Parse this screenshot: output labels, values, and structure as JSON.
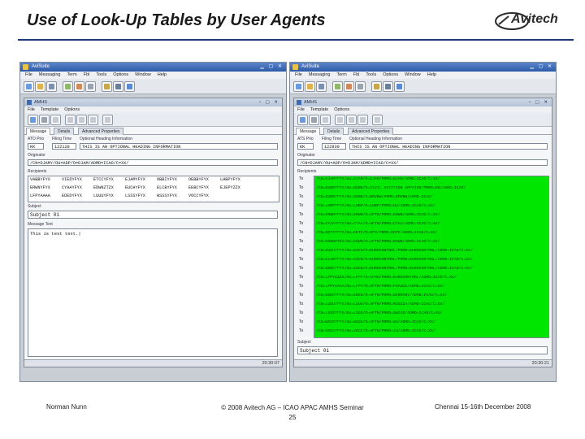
{
  "slide": {
    "title": "Use of Look-Up Tables by User Agents",
    "logo_text": "Avitech",
    "footer_left": "Norman Nunn",
    "footer_center_line1": "© 2008 Avitech AG – ICAO APAC AMHS Seminar",
    "footer_center_line2": "25",
    "footer_right": "Chennai 15-16th December 2008"
  },
  "left": {
    "app_title": "AviSuite",
    "menu": [
      "File",
      "Messaging",
      "Term",
      "Fbl",
      "Tools",
      "Options",
      "Window",
      "Help"
    ],
    "inner_title": "AMHS",
    "inner_menu": [
      "File",
      "Template",
      "Options"
    ],
    "tabs": [
      "Message",
      "Details",
      "Advanced Properties"
    ],
    "ato_label": "ATO Prio",
    "filing_label": "Filing Time",
    "heading_label": "Optional Heading Information",
    "prio": "KK",
    "filing_time": "122128",
    "heading_info": "THIS IS AN OPTIONAL HEADING INFORMATION",
    "originator_label": "Originator",
    "originator": "/CN=DJAMY/OU=ADP/O=DJAM/ADMD=ICAO/C=XX/",
    "recipients_label": "Recipients",
    "recipients": [
      [
        "VABBYFYX",
        "VIEDYFYX",
        "ETCCYFYX",
        "EJAMYFYX",
        "OBBIYFYX",
        "OEBBYFYX",
        "LHBPYFYX"
      ],
      [
        "ERWNYFYX",
        "CYAAYFYX",
        "EDWNZTZX",
        "EUCHYFYX",
        "ELCBYFYX",
        "EEBCYFYX",
        "EJEPYZZX"
      ],
      [
        "LFPYAAAA",
        "EDEDYFYX",
        "LUUUYFYX",
        "LSSSYFYX",
        "WSSSYFYX",
        "VOCCYFYX"
      ]
    ],
    "subject_label": "Subject",
    "subject": "Subject 01",
    "message_label": "Message Text",
    "message": "This is test text.",
    "status_time": "20:30:07"
  },
  "right": {
    "app_title": "AviSuite",
    "menu": [
      "File",
      "Messaging",
      "Term",
      "Fbl",
      "Tools",
      "Options",
      "Window",
      "Help"
    ],
    "inner_title": "AMHS",
    "inner_menu": [
      "File",
      "Template",
      "Options"
    ],
    "tabs": [
      "Message",
      "Details",
      "Advanced Properties"
    ],
    "ato_label": "ATS Prio",
    "filing_label": "Filing Time",
    "heading_label": "Optional Heading Information",
    "prio": "KK",
    "filing_time": "122930",
    "heading_info": "THIS IS AN OPTIONAL HEADING INFORMATION",
    "originator_label": "Originator",
    "originator": "/CN=DJAMY/OU=ADP/O=DJAM/ADMD=ICAO/C=XX/",
    "recipients_label": "Recipients",
    "to_label": "To",
    "recipients": [
      "/CN=DJAMYFYX/OU=DJAM/O=DJAM/PRMD=DJAM/ADMD=ICAO/C=XX/",
      "/CN=DUBBYFYX/OU=DUBB/O=CIVIL AVIATION AFFAIRS/PRMD=DB/ADMD=ICAO/",
      "/CN=DUBBYFYX/OU=DUBB/O=BMVBW/PRMD=BMVBW/ADMD=ICAO/",
      "/CN=LHBPYFYX/OU=LHBP/O=LHBP/PRMD=HU/ADMD=ICAO/C=XX/",
      "/CN=ERWNYFYX/OU=ERWN/O=AFTN/PRMD=ERWN/ADMD=ICAO/C=XX/",
      "/CN=CYAAYFYX/OU=CYAA/O=AFTN/PRMD=CYAA/ADMD=ICAO/C=XX/",
      "/CN=EDTCYFYX/OU=EDTC/O=DFS/PRMD=EDTC/ADMD=ICAO/C=XX/",
      "/CN=EDWNZTZX/OU=EDWN/O=AFTN/PRMD=EDWN/ADMD=ICAO/C=XX/",
      "/CN=EUCHYFYX/OU=EUCH/O=EUROCONTROL/PRMD=EUROCONTROL/ADMD=ICAO/C=XX/",
      "/CN=ELCBYFYX/OU=EUCB/O=EUROCONTROL/PRMD=EUROCONTROL/ADMD=ICAO/C=XX/",
      "/CN=EEBCYFYX/OU=EUCB/O=EUROCONTROL/PRMD=EUROCONTROL/ADMD=ICAO/C=XX/",
      "/CN=LFPYZZZX/OU=LFPY/O=CFMU/PRMD=EUROCONTROL/ADMD=ICAO/C=XX/",
      "/CN=LFPYAAAA/OU=LFPY/O=AFTN/PRMD=FRANCE/ADMD=ICAO/C=XX/",
      "/CN=EDEDYFYX/OU=EDED/O=AFTN/PRMD=GERMANY/ADMD=ICAO/C=XX/",
      "/CN=LUUUYFYX/OU=LUUU/O=AFTN/PRMD=RUSSIA/ADMD=ICAO/C=XX/",
      "/CN=LSSSYFYX/OU=LSSS/O=AFTN/PRMD=SWISS/ADMD=ICAO/C=XX/",
      "/CN=WSSSYFYX/OU=WSSS/O=AFTN/PRMD=SG/ADMD=ICAO/C=XX/",
      "/CN=VOCCYFYX/OU=VOCC/O=AFTN/PRMD=IN/ADMD=ICAO/C=XX/"
    ],
    "subject_label": "Subject",
    "subject": "Subject 01",
    "status_time": "20:30:21"
  },
  "colors": {
    "title_rule": "#1f3a78",
    "recipient_highlight": "#00e600",
    "window_title": "#2d5aa8"
  }
}
